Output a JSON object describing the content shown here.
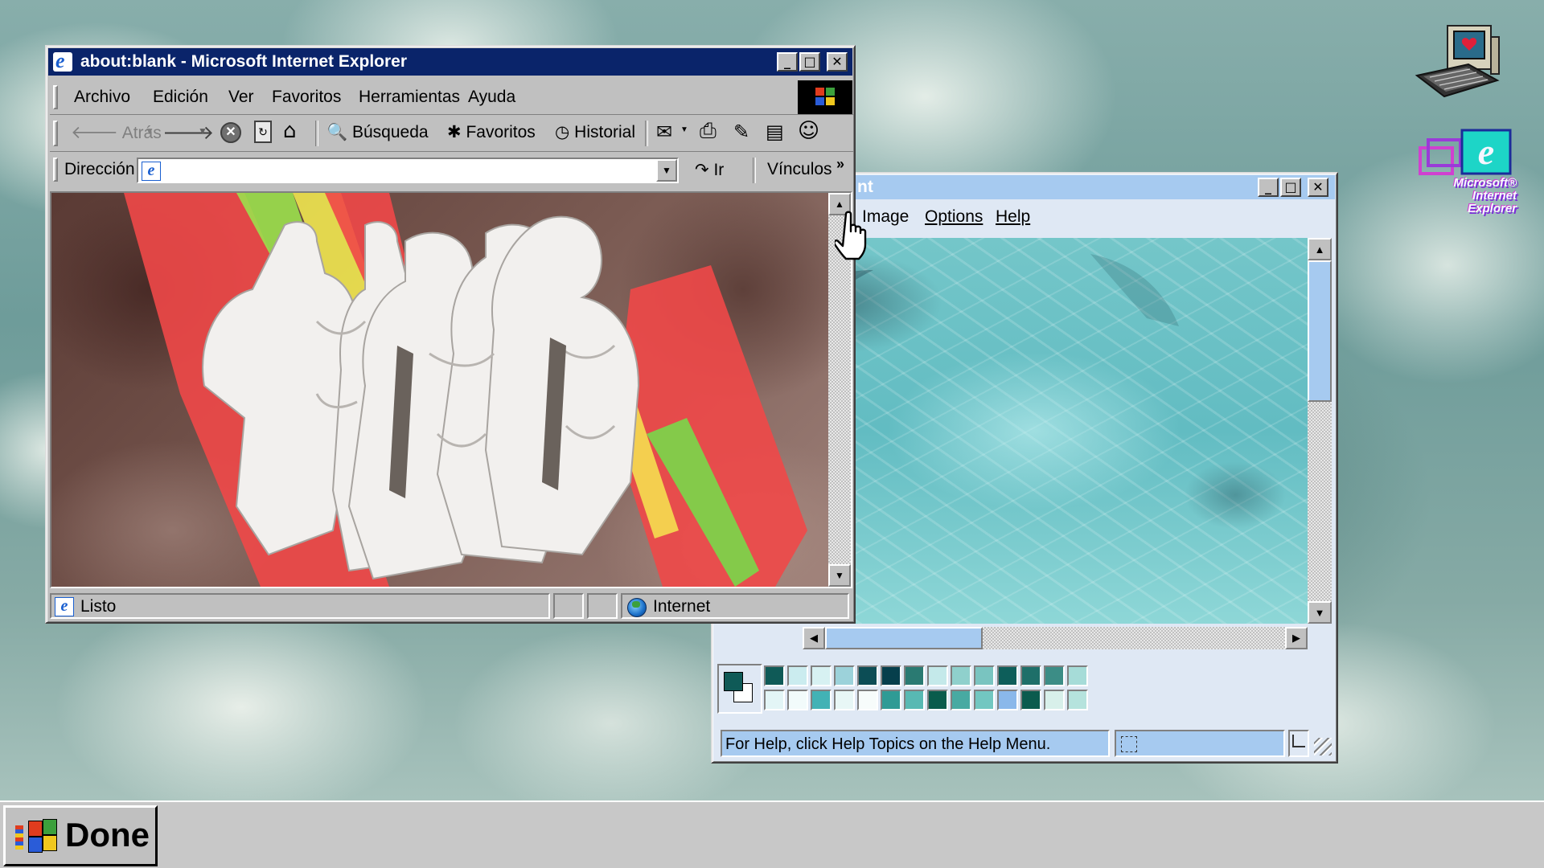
{
  "ie_window": {
    "title": "about:blank - Microsoft Internet Explorer",
    "menu": [
      "Archivo",
      "Edición",
      "Ver",
      "Favoritos",
      "Herramientas",
      "Ayuda"
    ],
    "toolbar": {
      "back": "Atrás",
      "search": "Búsqueda",
      "favorites": "Favoritos",
      "history": "Historial"
    },
    "address": {
      "label": "Dirección",
      "value": "",
      "go": "Ir",
      "links": "Vínculos"
    },
    "status": {
      "text": "Listo",
      "zone": "Internet"
    }
  },
  "paint_window": {
    "title_fragment": "nt",
    "menu": [
      "Image",
      "Options",
      "Help"
    ],
    "palette": {
      "row1": [
        "#0f5a57",
        "#cbecef",
        "#d7f1f2",
        "#9cd2da",
        "#0c4d55",
        "#063f4c",
        "#2a7a72",
        "#c4e9ea",
        "#8fd0cc",
        "#79c4c0",
        "#0d5e5a",
        "#1e6f69",
        "#3c8d86",
        "#a6dcd8"
      ],
      "row2": [
        "#e3f5f6",
        "#f2fbfb",
        "#42b2b5",
        "#e8f7f6",
        "#f7fcfb",
        "#2f9b95",
        "#58b9b3",
        "#0a5c4c",
        "#48aaa2",
        "#72c7c1",
        "#8ab8ea",
        "#0b5b4e",
        "#d8f0ea",
        "#b5e3dd"
      ],
      "foreground": "#0f5a57",
      "background": "#ffffff"
    },
    "status": "For Help, click Help Topics on the Help Menu."
  },
  "taskbar": {
    "start_label": "Done"
  },
  "desktop_icons": {
    "ie_logo_text": "Microsoft® Internet Explorer"
  },
  "colors": {
    "ie_titlebar": "#0a246a",
    "paint_titlebar": "#a6caf0",
    "window_face": "#c0c0c0",
    "paint_face": "#dfe8f4"
  }
}
